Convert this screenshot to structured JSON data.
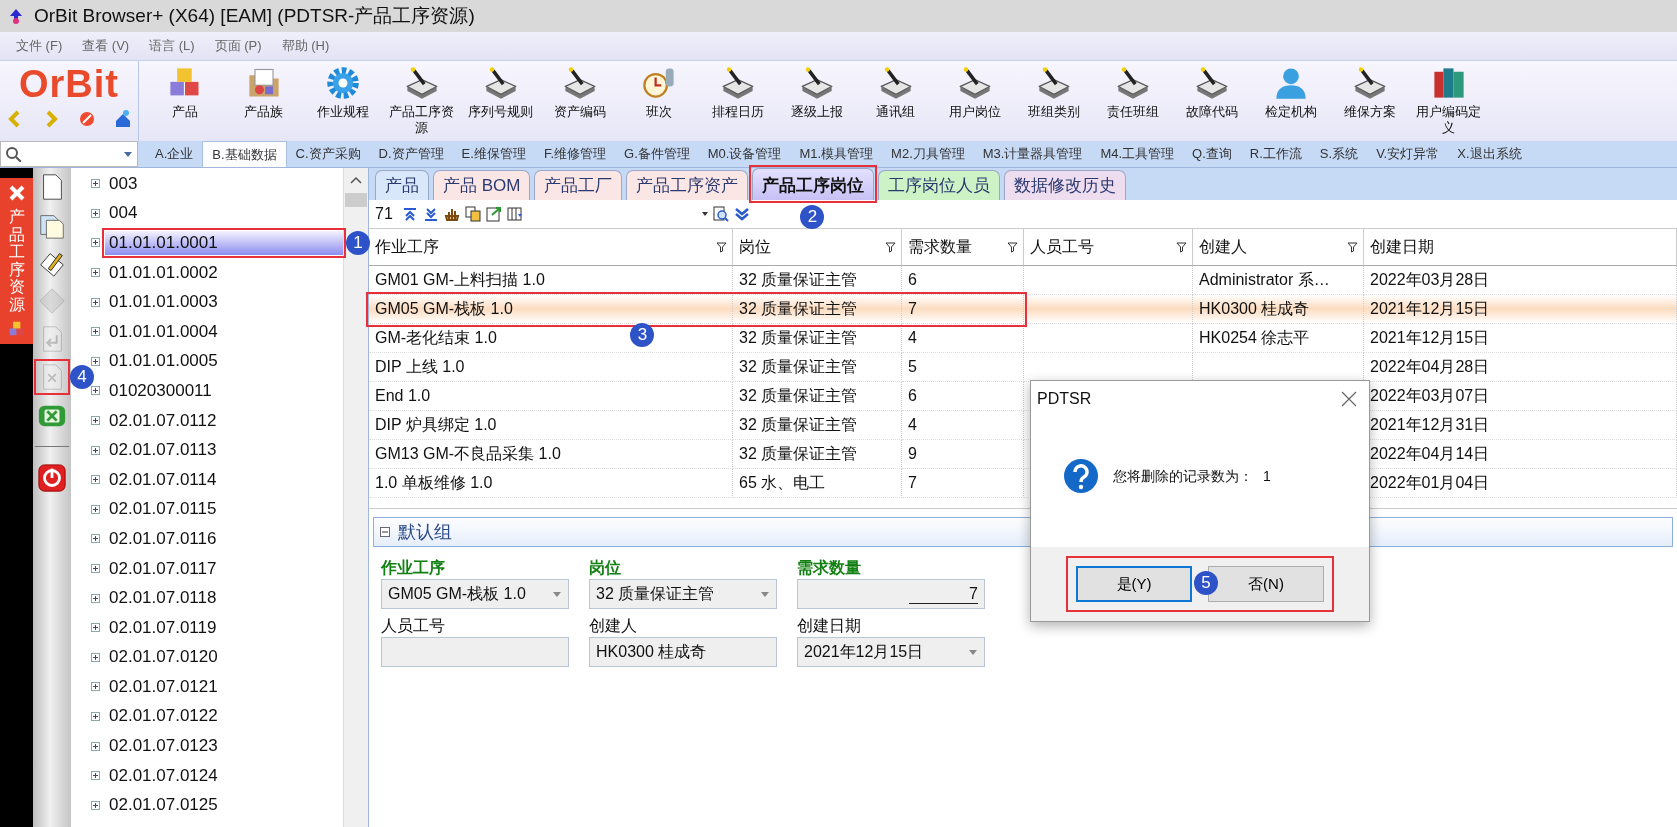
{
  "window": {
    "title": "OrBit Browser+ (X64) [EAM] (PDTSR-产品工序资源)"
  },
  "menu": [
    "文件 (F)",
    "查看 (V)",
    "语言 (L)",
    "页面 (P)",
    "帮助 (H)"
  ],
  "logo": {
    "text": "OrBit"
  },
  "toolbar": [
    {
      "label": "产品",
      "kind": "blocks"
    },
    {
      "label": "产品族",
      "kind": "folder"
    },
    {
      "label": "作业规程",
      "kind": "gear"
    },
    {
      "label": "产品工序资源",
      "kind": "device"
    },
    {
      "label": "序列号规则",
      "kind": "device"
    },
    {
      "label": "资产编码",
      "kind": "device"
    },
    {
      "label": "班次",
      "kind": "clock"
    },
    {
      "label": "排程日历",
      "kind": "device"
    },
    {
      "label": "逐级上报",
      "kind": "device"
    },
    {
      "label": "通讯组",
      "kind": "device"
    },
    {
      "label": "用户岗位",
      "kind": "device"
    },
    {
      "label": "班组类别",
      "kind": "device"
    },
    {
      "label": "责任班组",
      "kind": "device"
    },
    {
      "label": "故障代码",
      "kind": "device"
    },
    {
      "label": "检定机构",
      "kind": "person"
    },
    {
      "label": "维保方案",
      "kind": "device"
    },
    {
      "label": "用户编码定义",
      "kind": "books"
    }
  ],
  "modules": [
    {
      "label": "A.企业",
      "selected": false
    },
    {
      "label": "B.基础数据",
      "selected": true
    },
    {
      "label": "C.资产采购",
      "selected": false
    },
    {
      "label": "D.资产管理",
      "selected": false
    },
    {
      "label": "E.维保管理",
      "selected": false
    },
    {
      "label": "F.维修管理",
      "selected": false
    },
    {
      "label": "G.备件管理",
      "selected": false
    },
    {
      "label": "M0.设备管理",
      "selected": false
    },
    {
      "label": "M1.模具管理",
      "selected": false
    },
    {
      "label": "M2.刀具管理",
      "selected": false
    },
    {
      "label": "M3.计量器具管理",
      "selected": false
    },
    {
      "label": "M4.工具管理",
      "selected": false
    },
    {
      "label": "Q.查询",
      "selected": false
    },
    {
      "label": "R.工作流",
      "selected": false
    },
    {
      "label": "S.系统",
      "selected": false
    },
    {
      "label": "V.安灯异常",
      "selected": false
    },
    {
      "label": "X.退出系统",
      "selected": false
    }
  ],
  "side_tab": {
    "label": "产品工序资源"
  },
  "tools": [
    {
      "kind": "page",
      "disabled": false
    },
    {
      "kind": "pages",
      "disabled": false
    },
    {
      "kind": "pencil",
      "disabled": false
    },
    {
      "kind": "diamond",
      "disabled": true
    },
    {
      "kind": "undo",
      "disabled": true
    },
    {
      "kind": "delete",
      "disabled": true,
      "callout": "4"
    },
    {
      "kind": "excel",
      "disabled": false
    },
    {
      "kind": "power",
      "disabled": false
    }
  ],
  "tree": [
    {
      "label": "003",
      "selected": false
    },
    {
      "label": "004",
      "selected": false
    },
    {
      "label": "01.01.01.0001",
      "selected": true,
      "callout": "1"
    },
    {
      "label": "01.01.01.0002",
      "selected": false
    },
    {
      "label": "01.01.01.0003",
      "selected": false
    },
    {
      "label": "01.01.01.0004",
      "selected": false
    },
    {
      "label": "01.01.01.0005",
      "selected": false
    },
    {
      "label": "01020300011",
      "selected": false
    },
    {
      "label": "02.01.07.0112",
      "selected": false
    },
    {
      "label": "02.01.07.0113",
      "selected": false
    },
    {
      "label": "02.01.07.0114",
      "selected": false
    },
    {
      "label": "02.01.07.0115",
      "selected": false
    },
    {
      "label": "02.01.07.0116",
      "selected": false
    },
    {
      "label": "02.01.07.0117",
      "selected": false
    },
    {
      "label": "02.01.07.0118",
      "selected": false
    },
    {
      "label": "02.01.07.0119",
      "selected": false
    },
    {
      "label": "02.01.07.0120",
      "selected": false
    },
    {
      "label": "02.01.07.0121",
      "selected": false
    },
    {
      "label": "02.01.07.0122",
      "selected": false
    },
    {
      "label": "02.01.07.0123",
      "selected": false
    },
    {
      "label": "02.01.07.0124",
      "selected": false
    },
    {
      "label": "02.01.07.0125",
      "selected": false
    }
  ],
  "tabs": [
    {
      "label": "产品",
      "selected": false,
      "color": "#d9e7fb"
    },
    {
      "label": "产品 BOM",
      "selected": false,
      "color": "#fbe6e6"
    },
    {
      "label": "产品工厂",
      "selected": false,
      "color": "#fbe6e6"
    },
    {
      "label": "产品工序资产",
      "selected": false,
      "color": "#fbe6e6"
    },
    {
      "label": "产品工序岗位",
      "selected": true,
      "color": "#c6c1f4",
      "callout": "2"
    },
    {
      "label": "工序岗位人员",
      "selected": false,
      "color": "#cdf2c6"
    },
    {
      "label": "数据修改历史",
      "selected": false,
      "color": "#eedcef"
    }
  ],
  "pager": {
    "count": "71"
  },
  "table": {
    "columns": [
      {
        "label": "作业工序",
        "filter": true
      },
      {
        "label": "岗位",
        "filter": true
      },
      {
        "label": "需求数量",
        "filter": true
      },
      {
        "label": "人员工号",
        "filter": true
      },
      {
        "label": "创建人",
        "filter": true
      },
      {
        "label": "创建日期",
        "filter": false
      }
    ],
    "rows": [
      {
        "operation": "GM01  GM-上料扫描 1.0",
        "post": "32 质量保证主管",
        "quantity": "6",
        "creator": "Administrator 系…",
        "created": "2022年03月28日",
        "selected": false
      },
      {
        "operation": "GM05  GM-栈板 1.0",
        "post": "32 质量保证主管",
        "quantity": "7",
        "creator": "HK0300 桂成奇",
        "created": "2021年12月15日",
        "selected": true,
        "callout": "3"
      },
      {
        "operation": "GM-老化结束 1.0",
        "post": "32 质量保证主管",
        "quantity": "4",
        "creator": "HK0254 徐志平",
        "created": "2021年12月15日",
        "selected": false
      },
      {
        "operation": "DIP 上线 1.0",
        "post": "32 质量保证主管",
        "quantity": "5",
        "created": "2022年04月28日",
        "selected": false
      },
      {
        "operation": "End 1.0",
        "post": "32 质量保证主管",
        "quantity": "6",
        "created": "2022年03月07日",
        "selected": false
      },
      {
        "operation": "DIP 炉具绑定 1.0",
        "post": "32 质量保证主管",
        "quantity": "4",
        "created": "2021年12月31日",
        "selected": false
      },
      {
        "operation": "GM13  GM-不良品采集 1.0",
        "post": "32 质量保证主管",
        "quantity": "9",
        "created": "2022年04月14日",
        "selected": false
      },
      {
        "operation": "1.0 单板维修 1.0",
        "post": "65 水、电工",
        "quantity": "7",
        "created": "2022年01月04日",
        "selected": false
      }
    ]
  },
  "group": {
    "title": "默认组",
    "expanded": true
  },
  "form": [
    {
      "label": "作业工序",
      "required": true,
      "kind": "combo",
      "value": "GM05  GM-栈板 1.0"
    },
    {
      "label": "岗位",
      "required": true,
      "kind": "combo",
      "value": "32 质量保证主管"
    },
    {
      "label": "需求数量",
      "required": true,
      "kind": "number",
      "value": "7"
    },
    {
      "label": "人员工号",
      "required": false,
      "kind": "text"
    },
    {
      "label": "创建人",
      "required": false,
      "kind": "text",
      "value": "HK0300 桂成奇"
    },
    {
      "label": "创建日期",
      "required": false,
      "kind": "combo",
      "value": "2021年12月15日"
    }
  ],
  "dialog": {
    "title": "PDTSR",
    "message": "您将删除的记录数为：",
    "count": "1",
    "callout": "5",
    "buttons": [
      {
        "label": "是(Y)",
        "default": true
      },
      {
        "label": "否(N)",
        "default": false
      }
    ]
  }
}
